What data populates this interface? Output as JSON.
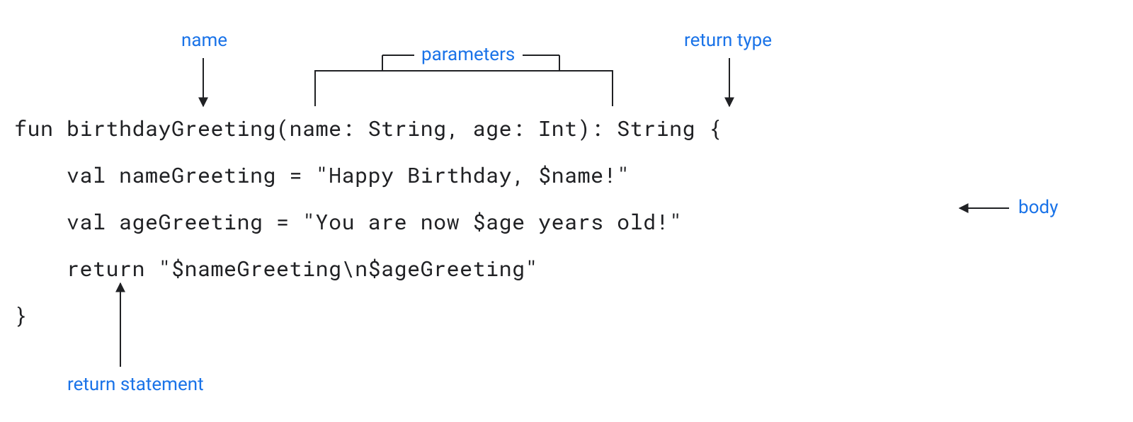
{
  "labels": {
    "name": "name",
    "parameters": "parameters",
    "return_type": "return type",
    "body": "body",
    "return_statement": "return statement"
  },
  "code": {
    "line1": "fun birthdayGreeting(name: String, age: Int): String {",
    "line2": "    val nameGreeting = \"Happy Birthday, $name!\"",
    "line3": "    val ageGreeting = \"You are now $age years old!\"",
    "line4": "    return \"$nameGreeting\\n$ageGreeting\"",
    "line5": "}"
  }
}
